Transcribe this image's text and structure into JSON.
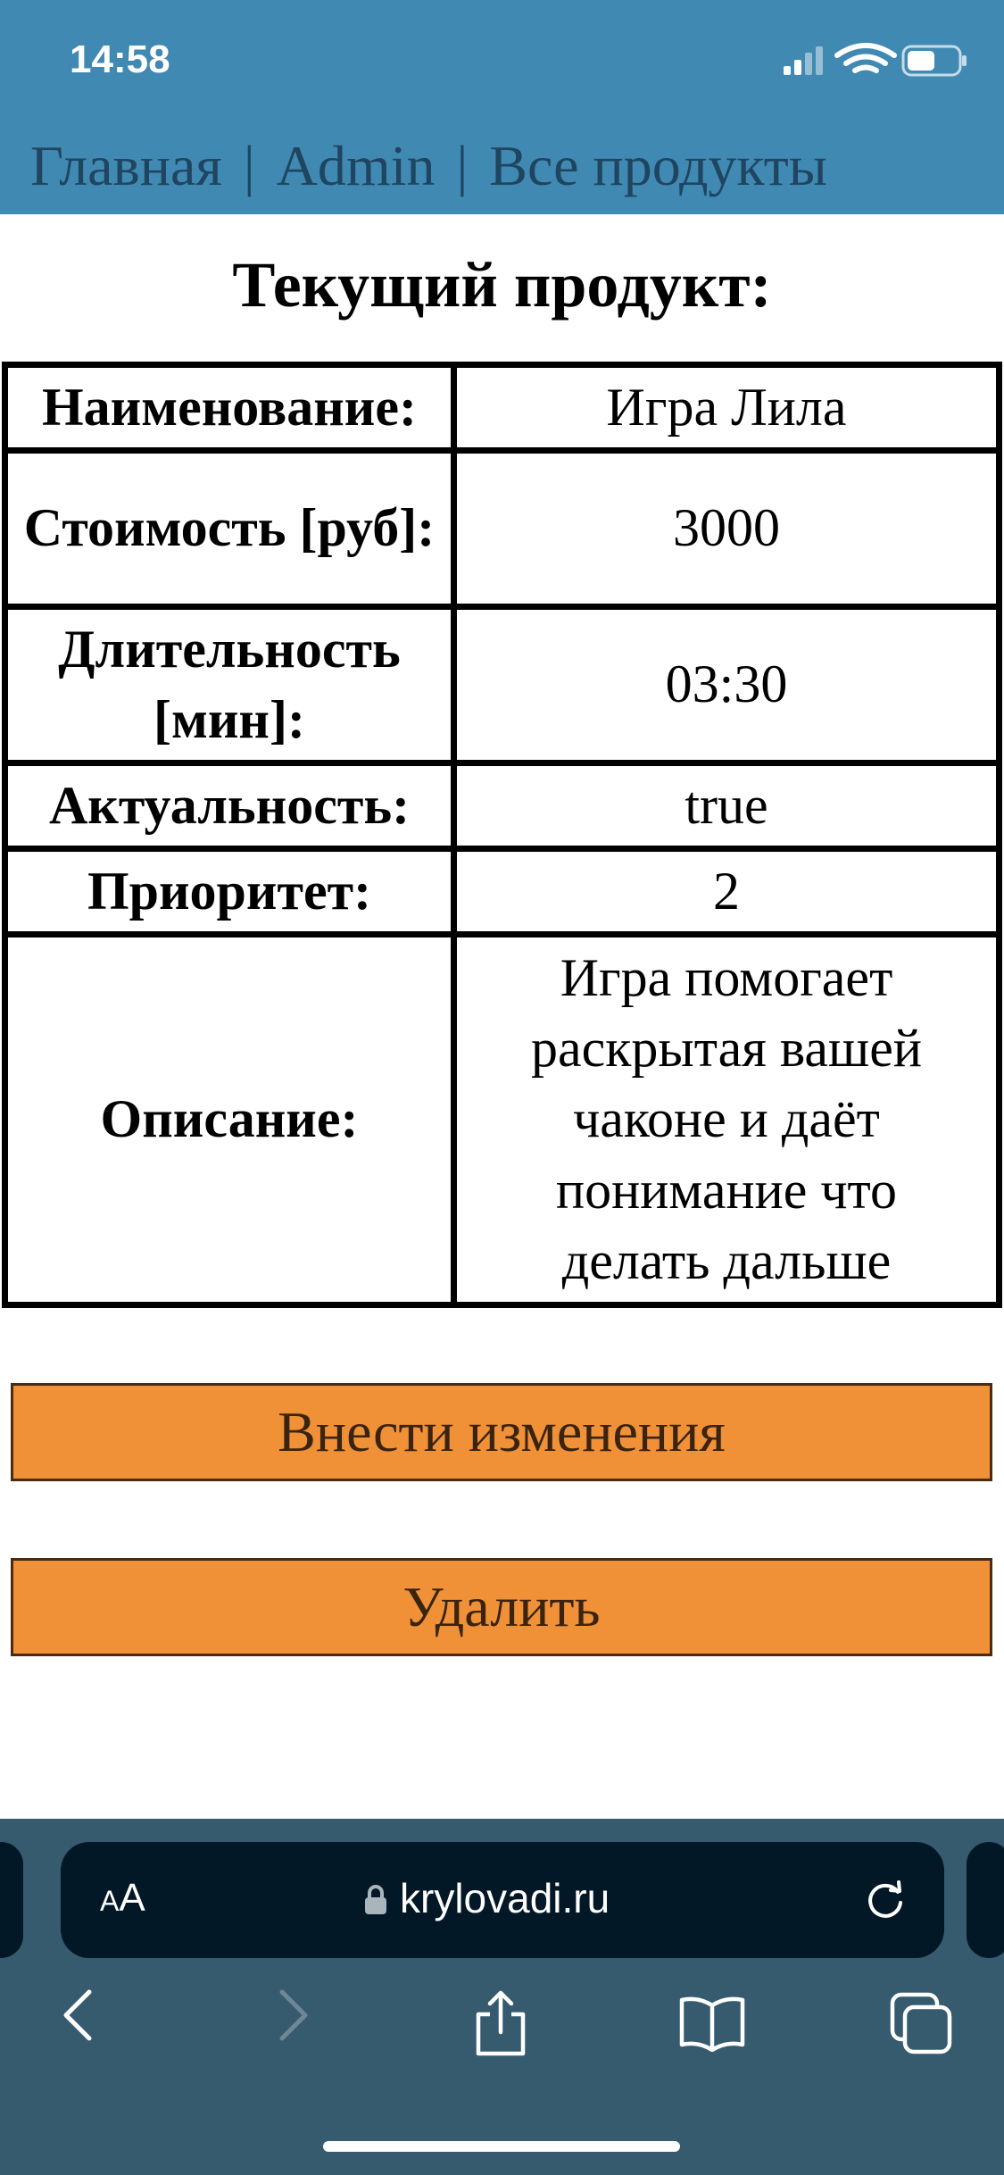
{
  "status_bar": {
    "time": "14:58"
  },
  "nav": {
    "home": "Главная",
    "separator": "|",
    "admin": "Admin",
    "all_products": "Все продукты"
  },
  "page_title": "Текущий продукт:",
  "product_table": {
    "rows": [
      {
        "label": "Наименование:",
        "value": "Игра Лила"
      },
      {
        "label": "Стоимость [руб]:",
        "value": "3000"
      },
      {
        "label": "Длительность [мин]:",
        "value": "03:30"
      },
      {
        "label": "Актуальность:",
        "value": "true"
      },
      {
        "label": "Приоритет:",
        "value": "2"
      },
      {
        "label": "Описание:",
        "value": "Игра помогает раскрытая вашей чаконе и даёт понимание что делать дальше"
      }
    ]
  },
  "buttons": {
    "edit": "Внести изменения",
    "delete": "Удалить"
  },
  "browser": {
    "text_size_small": "A",
    "text_size_big": "A",
    "url": "krylovadi.ru"
  },
  "colors": {
    "header_bg": "#4089b2",
    "button_bg": "#f09138",
    "browser_bar_bg": "#365a6e",
    "url_field_bg": "#031826"
  }
}
